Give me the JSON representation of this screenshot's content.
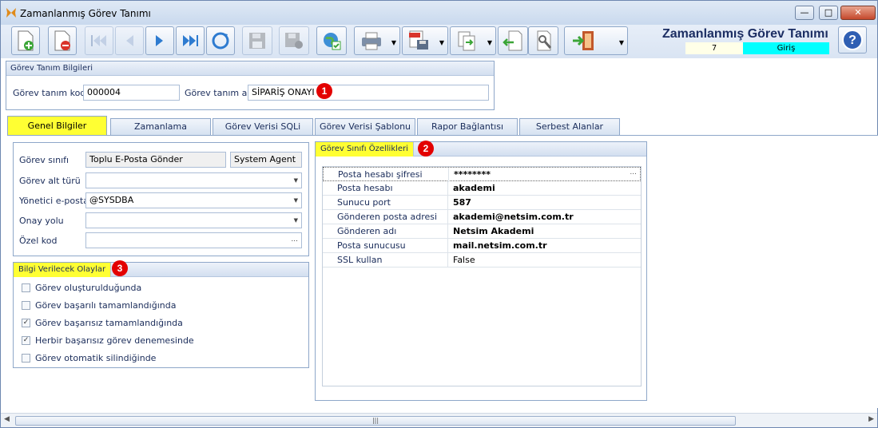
{
  "window": {
    "title": "Zamanlanmış Görev Tanımı",
    "minimize": "—",
    "maximize": "□",
    "close": "✕"
  },
  "header": {
    "app_title": "Zamanlanmış Görev Tanımı",
    "record_count": "7",
    "status": "Giriş"
  },
  "colors": {
    "accent": "#ffff33",
    "status_bg": "#00ffff",
    "badge": "#e30000",
    "title": "#1c2e63"
  },
  "definition": {
    "group_title": "Görev Tanım Bilgileri",
    "code_label": "Görev tanım kodu",
    "code_value": "000004",
    "name_label": "Görev tanım adı",
    "name_value": "SİPARİŞ ONAYI",
    "badge": "1"
  },
  "tabs": [
    "Genel Bilgiler",
    "Zamanlama",
    "Görev Verisi SQLi",
    "Görev Verisi Şablonu",
    "Rapor Bağlantısı",
    "Serbest Alanlar"
  ],
  "general": {
    "class_label": "Görev sınıfı",
    "class_value": "Toplu E-Posta Gönder",
    "class_agent": "System Agent",
    "subtype_label": "Görev alt türü",
    "subtype_value": "",
    "admin_mail_label": "Yönetici e-posta",
    "admin_mail_value": "@SYSDBA",
    "approval_label": "Onay yolu",
    "approval_value": "",
    "special_label": "Özel kod",
    "special_value": "",
    "special_button": "..."
  },
  "events": {
    "group_title": "Bilgi Verilecek Olaylar",
    "badge": "3",
    "items": [
      {
        "label": "Görev oluşturulduğunda",
        "checked": false
      },
      {
        "label": "Görev başarılı tamamlandığında",
        "checked": false
      },
      {
        "label": "Görev başarısız tamamlandığında",
        "checked": true
      },
      {
        "label": "Herbir başarısız görev denemesinde",
        "checked": true
      },
      {
        "label": "Görev otomatik silindiğinde",
        "checked": false
      }
    ]
  },
  "properties": {
    "group_title": "Görev Sınıfı Özellikleri",
    "badge": "2",
    "rows": [
      {
        "key": "Posta hesabı şifresi",
        "value": "********"
      },
      {
        "key": "Posta hesabı",
        "value": "akademi"
      },
      {
        "key": "Sunucu port",
        "value": "587"
      },
      {
        "key": "Gönderen posta adresi",
        "value": "akademi@netsim.com.tr"
      },
      {
        "key": "Gönderen adı",
        "value": "Netsim Akademi"
      },
      {
        "key": "Posta sunucusu",
        "value": "mail.netsim.com.tr"
      },
      {
        "key": "SSL kullan",
        "value": "False"
      }
    ],
    "row_button": "..."
  },
  "toolbar_icons": [
    "new-document-icon",
    "delete-document-icon",
    "first-record-icon",
    "previous-record-icon",
    "next-record-icon",
    "last-record-icon",
    "refresh-icon",
    "save-icon",
    "cancel-save-icon",
    "web-check-icon",
    "print-icon",
    "export-pdf-icon",
    "copy-icon",
    "import-icon",
    "tools-icon",
    "exit-icon"
  ]
}
